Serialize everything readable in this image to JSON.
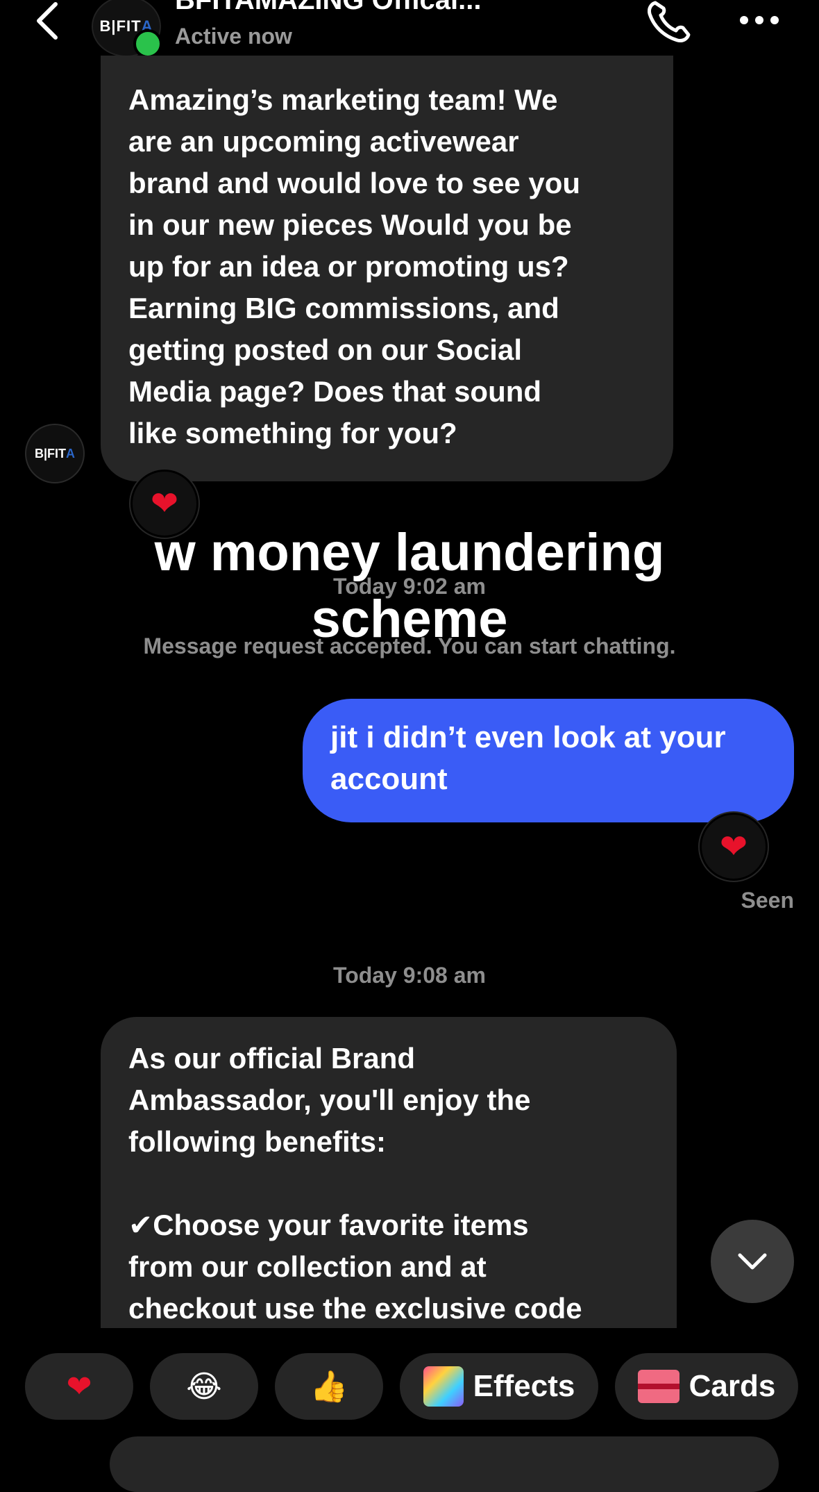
{
  "header": {
    "title": "BFITAMAZING Offical...",
    "status": "Active now",
    "avatar_text": "B|FIT",
    "avatar_accent": "A"
  },
  "messages": {
    "incoming_1": "Amazing’s marketing team! We\nare an upcoming activewear\nbrand and would love to see you\nin our new pieces Would you be\nup for an idea or promoting us?\nEarning BIG commissions, and\ngetting posted on our Social\nMedia page? Does that sound\nlike something for you?",
    "outgoing_1": "jit i didn’t even look at your account",
    "incoming_2": "As our official Brand\nAmbassador, you'll enjoy the\nfollowing benefits:\n\n✔Choose your favorite items\nfrom our collection and at\ncheckout use the exclusive code"
  },
  "overlay_caption": "w money laundering\nscheme",
  "timestamps": {
    "first": "Today 9:02 am",
    "second": "Today 9:08 am"
  },
  "system_note": "Message request accepted. You can start chatting.",
  "seen_label": "Seen",
  "reactions": {
    "heart": "❤",
    "laugh": "😂",
    "thumbs": "👍"
  },
  "quick_actions": {
    "effects_label": "Effects",
    "cards_label": "Cards"
  },
  "colors": {
    "outgoing_bubble": "#3a5cf6",
    "incoming_bubble": "#262626",
    "presence": "#2ac24b",
    "heart": "#e8122b"
  }
}
